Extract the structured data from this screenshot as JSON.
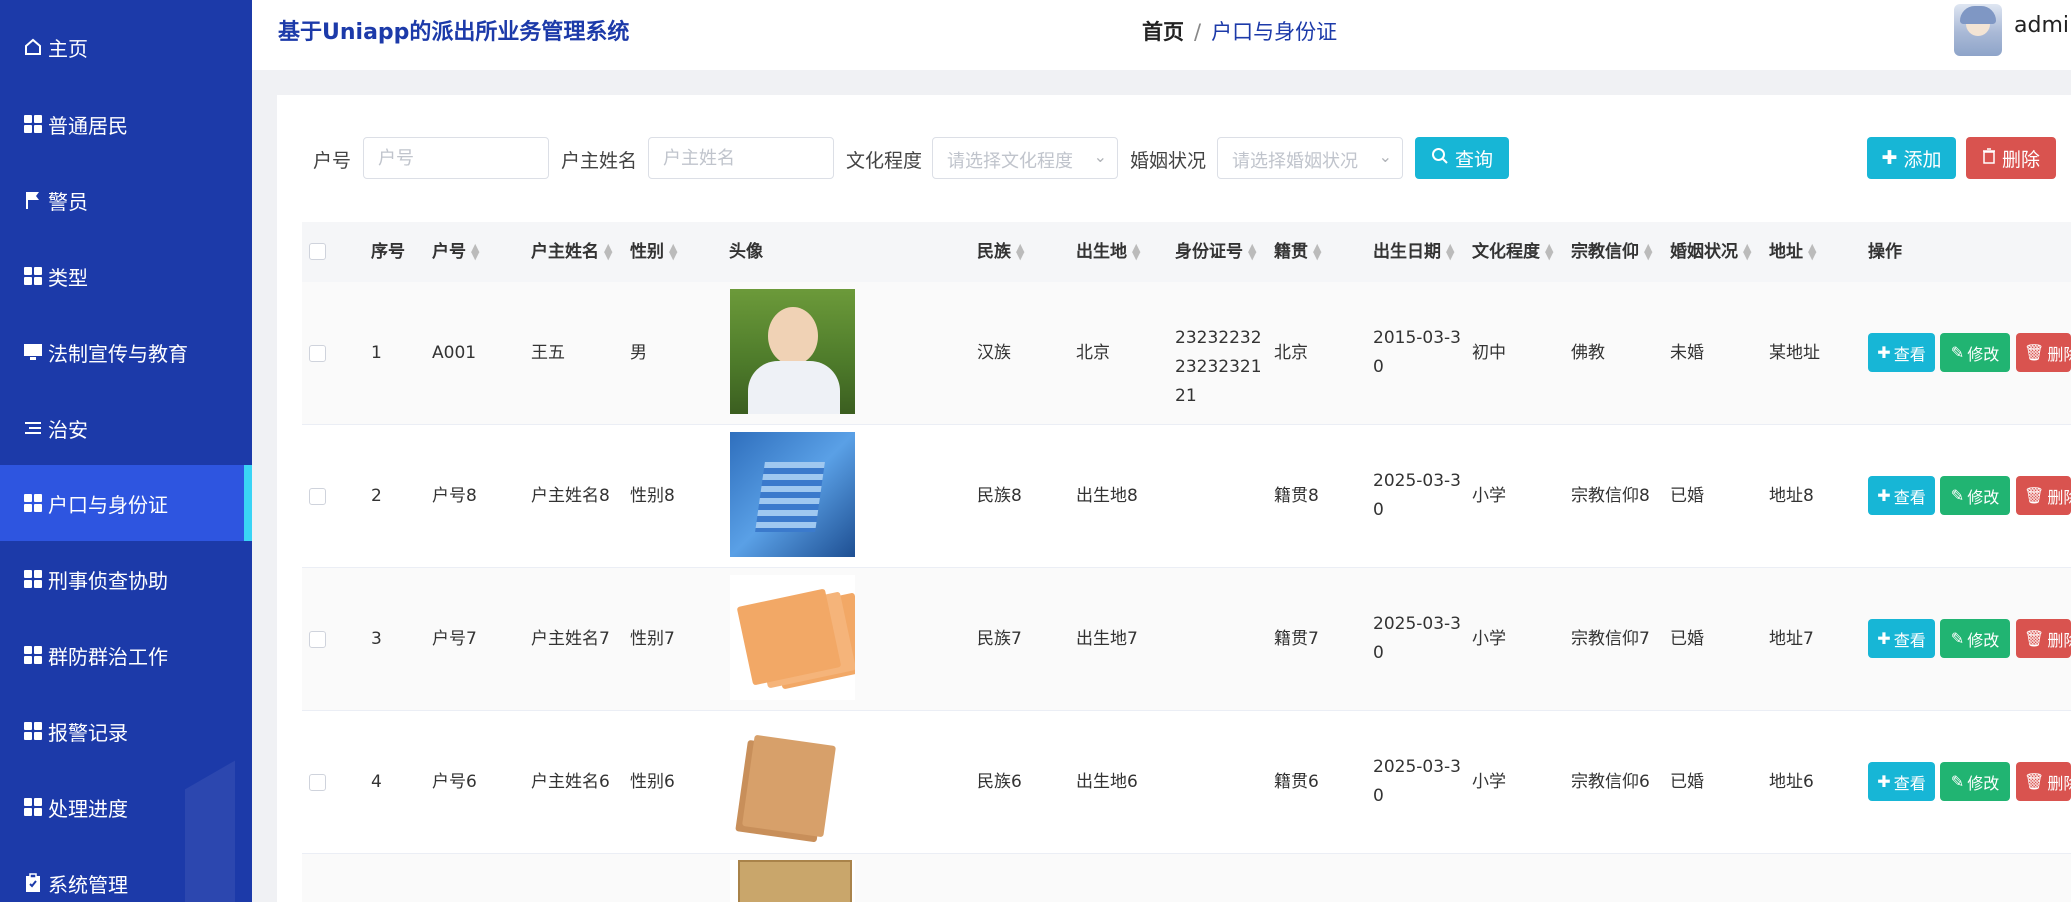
{
  "sidebar": {
    "items": [
      {
        "label": "主页",
        "icon": "home-icon"
      },
      {
        "label": "普通居民",
        "icon": "grid-icon"
      },
      {
        "label": "警员",
        "icon": "flag-icon"
      },
      {
        "label": "类型",
        "icon": "grid-icon"
      },
      {
        "label": "法制宣传与教育",
        "icon": "monitor-icon"
      },
      {
        "label": "治安",
        "icon": "list-icon"
      },
      {
        "label": "户口与身份证",
        "icon": "grid-icon",
        "active": true
      },
      {
        "label": "刑事侦查协助",
        "icon": "grid-icon"
      },
      {
        "label": "群防群治工作",
        "icon": "grid-icon"
      },
      {
        "label": "报警记录",
        "icon": "grid-icon"
      },
      {
        "label": "处理进度",
        "icon": "grid-icon"
      },
      {
        "label": "系统管理",
        "icon": "clipboard-icon"
      }
    ]
  },
  "header": {
    "app_title": "基于Uniapp的派出所业务管理系统",
    "breadcrumb_home": "首页",
    "breadcrumb_sep": "/",
    "breadcrumb_current": "户口与身份证",
    "username": "admin"
  },
  "search": {
    "hu_hao_label": "户号",
    "hu_hao_placeholder": "户号",
    "huzhu_label": "户主姓名",
    "huzhu_placeholder": "户主姓名",
    "wenhua_label": "文化程度",
    "wenhua_placeholder": "请选择文化程度",
    "hunyin_label": "婚姻状况",
    "hunyin_placeholder": "请选择婚姻状况",
    "query_label": "查询"
  },
  "toolbar": {
    "add_label": "添加",
    "delete_label": "删除"
  },
  "table": {
    "columns": {
      "index": "序号",
      "hu_hao": "户号",
      "huzhu": "户主姓名",
      "gender": "性别",
      "avatar": "头像",
      "ethnicity": "民族",
      "birthplace": "出生地",
      "id_number": "身份证号",
      "native_place": "籍贯",
      "birth_date": "出生日期",
      "education": "文化程度",
      "religion": "宗教信仰",
      "marital": "婚姻状况",
      "address": "地址",
      "actions": "操作"
    },
    "rows": [
      {
        "index": "1",
        "hu_hao": "A001",
        "huzhu": "王五",
        "gender": "男",
        "ethnicity": "汉族",
        "birthplace": "北京",
        "id_number": "232322322323232121",
        "native_place": "北京",
        "birth_date": "2015-03-30",
        "education": "初中",
        "religion": "佛教",
        "marital": "未婚",
        "address": "某地址"
      },
      {
        "index": "2",
        "hu_hao": "户号8",
        "huzhu": "户主姓名8",
        "gender": "性别8",
        "ethnicity": "民族8",
        "birthplace": "出生地8",
        "id_number": "",
        "native_place": "籍贯8",
        "birth_date": "2025-03-30",
        "education": "小学",
        "religion": "宗教信仰8",
        "marital": "已婚",
        "address": "地址8"
      },
      {
        "index": "3",
        "hu_hao": "户号7",
        "huzhu": "户主姓名7",
        "gender": "性别7",
        "ethnicity": "民族7",
        "birthplace": "出生地7",
        "id_number": "",
        "native_place": "籍贯7",
        "birth_date": "2025-03-30",
        "education": "小学",
        "religion": "宗教信仰7",
        "marital": "已婚",
        "address": "地址7"
      },
      {
        "index": "4",
        "hu_hao": "户号6",
        "huzhu": "户主姓名6",
        "gender": "性别6",
        "ethnicity": "民族6",
        "birthplace": "出生地6",
        "id_number": "",
        "native_place": "籍贯6",
        "birth_date": "2025-03-30",
        "education": "小学",
        "religion": "宗教信仰6",
        "marital": "已婚",
        "address": "地址6"
      }
    ],
    "actions": {
      "view": "查看",
      "edit": "修改",
      "delete": "删除"
    }
  },
  "colors": {
    "sidebar_bg": "#1c3aa9",
    "sidebar_active": "#2e55e0",
    "accent_cyan": "#17b6d6",
    "edit_green": "#21b472",
    "delete_red": "#d9534f"
  }
}
